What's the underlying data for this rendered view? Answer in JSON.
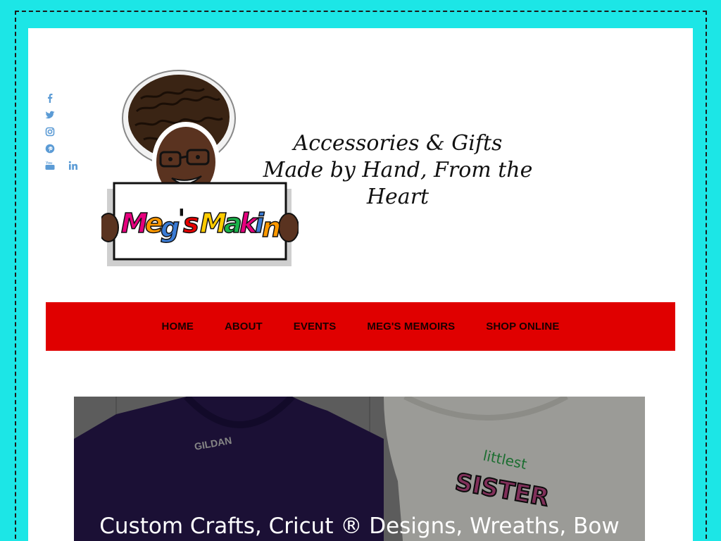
{
  "social": {
    "icons": [
      "facebook-icon",
      "twitter-icon",
      "instagram-icon",
      "pinterest-icon",
      "youtube-icon",
      "linkedin-icon"
    ],
    "color": "#5b9bd5"
  },
  "logo": {
    "sign_text": "Meg's Makings"
  },
  "tagline": {
    "line1": "Accessories & Gifts",
    "line2": "Made by Hand, From the Heart"
  },
  "nav": {
    "background": "#e00000",
    "items": [
      {
        "label": "HOME"
      },
      {
        "label": "ABOUT"
      },
      {
        "label": "EVENTS"
      },
      {
        "label": "MEG'S MEMOIRS"
      },
      {
        "label": "SHOP ONLINE"
      }
    ]
  },
  "hero": {
    "title": "Custom Crafts, Cricut ® Designs, Wreaths, Bow",
    "shirt_left_tag": "GILDAN",
    "shirt_right_text_top": "littlest",
    "shirt_right_text_bottom": "SISTER"
  },
  "colors": {
    "page_bg": "#1ce6e6",
    "content_bg": "#ffffff"
  }
}
